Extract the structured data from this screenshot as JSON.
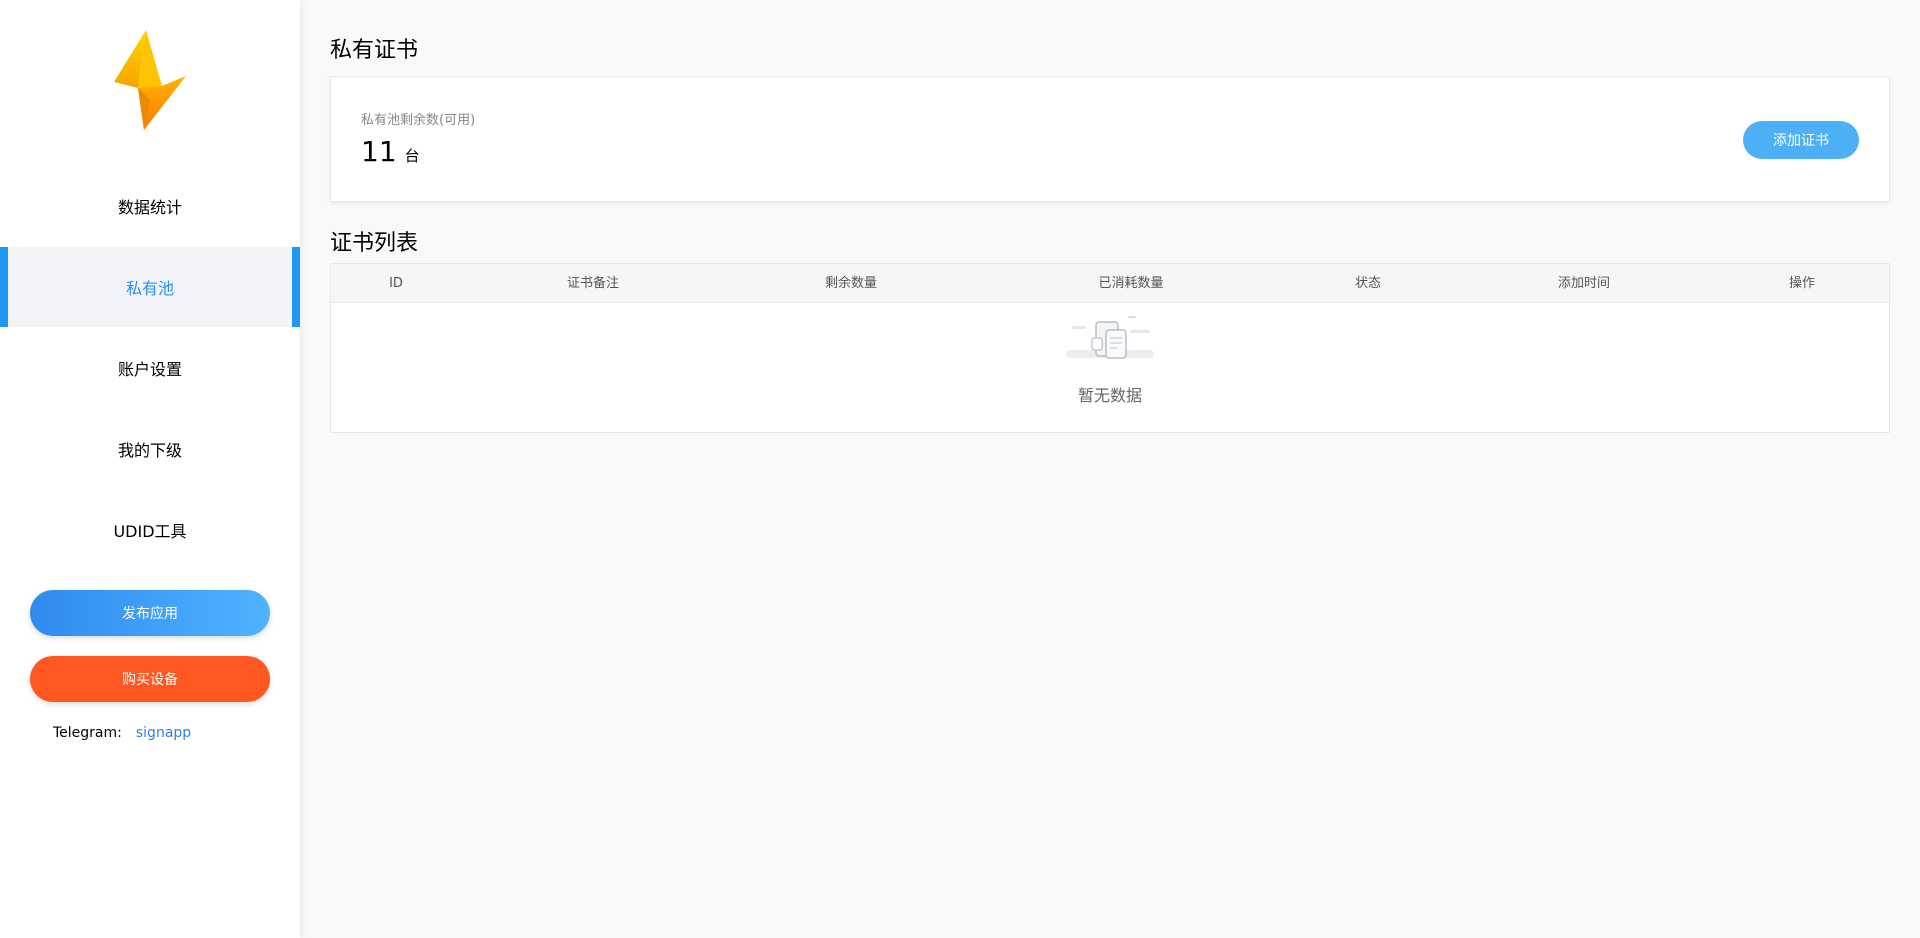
{
  "sidebar": {
    "items": [
      {
        "label": "数据统计",
        "active": false
      },
      {
        "label": "私有池",
        "active": true
      },
      {
        "label": "账户设置",
        "active": false
      },
      {
        "label": "我的下级",
        "active": false
      },
      {
        "label": "UDID工具",
        "active": false
      }
    ],
    "publish_label": "发布应用",
    "buy_label": "购买设备",
    "telegram_label": "Telegram:",
    "telegram_link": "signapp"
  },
  "main": {
    "title": "私有证书",
    "pool": {
      "label": "私有池剩余数(可用)",
      "count": "11",
      "unit": "台",
      "add_label": "添加证书"
    },
    "list_title": "证书列表",
    "columns": [
      "ID",
      "证书备注",
      "剩余数量",
      "已消耗数量",
      "状态",
      "添加时间",
      "操作"
    ],
    "rows": [],
    "empty_text": "暂无数据"
  },
  "colors": {
    "accent": "#2196f3",
    "buy": "#ff5722",
    "add_button": "#4db0f7"
  }
}
